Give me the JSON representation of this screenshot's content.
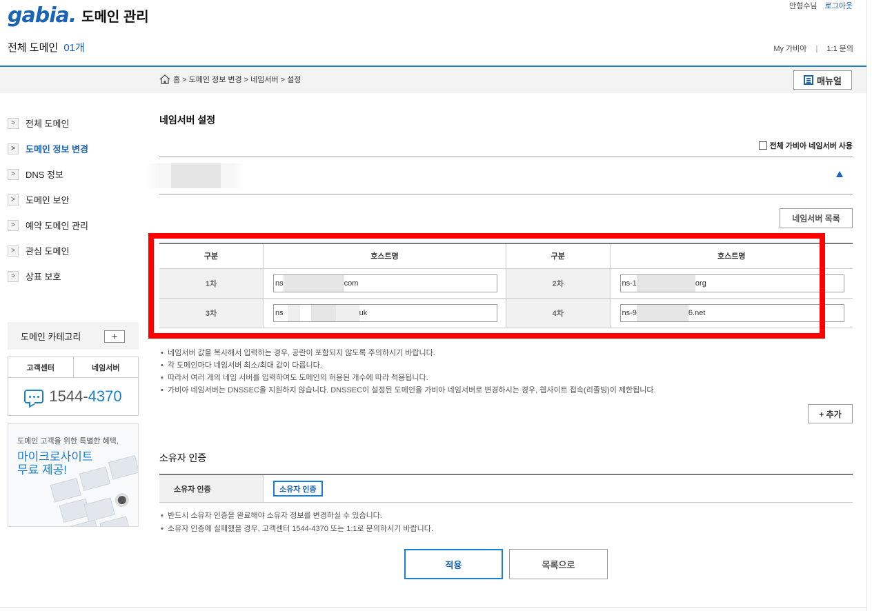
{
  "header": {
    "logo_text": "gabia.",
    "app_title": "도메인 관리",
    "greeting": "안형수님",
    "logout": "로그아웃",
    "total_domain_label": "전체 도메인",
    "total_domain_count": "01개",
    "my_gabia": "My 가비아",
    "separator": "|",
    "inquiry": "1:1 문의"
  },
  "breadcrumb": {
    "text": "홈 > 도메인 정보 변경 > 네임서버 > 설정",
    "manual_label": "매뉴얼"
  },
  "sidebar": {
    "items": [
      {
        "label": "전체 도메인",
        "active": false
      },
      {
        "label": "도메인 정보 변경",
        "active": true
      },
      {
        "label": "DNS 정보",
        "active": false
      },
      {
        "label": "도메인 보안",
        "active": false
      },
      {
        "label": "예약 도메인 관리",
        "active": false
      },
      {
        "label": "관심 도메인",
        "active": false
      },
      {
        "label": "상표 보호",
        "active": false
      }
    ],
    "category_label": "도메인 카테고리",
    "category_add": "+",
    "support_tabs": [
      "고객센터",
      "네임서버"
    ],
    "phone_prefix": "1544-",
    "phone_suffix": "4370",
    "banner_sub": "도메인 고객을 위한 특별한 혜택,",
    "banner_title_line1": "마이크로사이트",
    "banner_title_line2": "무료 제공!"
  },
  "nameserver": {
    "title": "네임서버 설정",
    "use_gabia_all": "전체 가비아 네임서버 사용",
    "list_button": "네임서버 목록",
    "col_division": "구분",
    "col_hostname": "호스트명",
    "rows": [
      {
        "label1": "1차",
        "host1_prefix": "ns",
        "host1_suffix": "com",
        "label2": "2차",
        "host2_prefix": "ns-1",
        "host2_suffix": "org"
      },
      {
        "label1": "3차",
        "host1_prefix": "ns",
        "host1_suffix": "uk",
        "label2": "4차",
        "host2_prefix": "ns-9",
        "host2_suffix": "6.net"
      }
    ],
    "notes": [
      "네임서버 값을 복사해서 입력하는 경우, 공란이 포함되지 않도록 주의하시기 바랍니다.",
      "각 도메인마다 네임서버 최소/최대 값이 다릅니다.",
      "따라서 여러 개의 네임 서버를 입력하여도 도메인의 허용된 개수에 따라 적용됩니다.",
      "가비아 네임서버는 DNSSEC을 지원하지 않습니다. DNSSEC이 설정된 도메인을 가비아 네임서버로 변경하시는 경우, 웹사이트 접속(리졸빙)이 제한됩니다."
    ],
    "add_button": "+ 추가"
  },
  "owner": {
    "title": "소유자 인증",
    "label": "소유자 인증",
    "button": "소유자 인증",
    "notes": [
      "반드시 소유자 인증을 완료해야 소유자 정보를 변경하실 수 있습니다.",
      "소유자 인증에 실패했을 경우, 고객센터 1544-4370 또는 1:1로 문의하시기 바랍니다."
    ]
  },
  "actions": {
    "apply": "적용",
    "back_to_list": "목록으로"
  },
  "colors": {
    "brand_blue": "#1a63b5",
    "accent_blue": "#1a7fd0",
    "highlight_red": "#ff0000"
  }
}
